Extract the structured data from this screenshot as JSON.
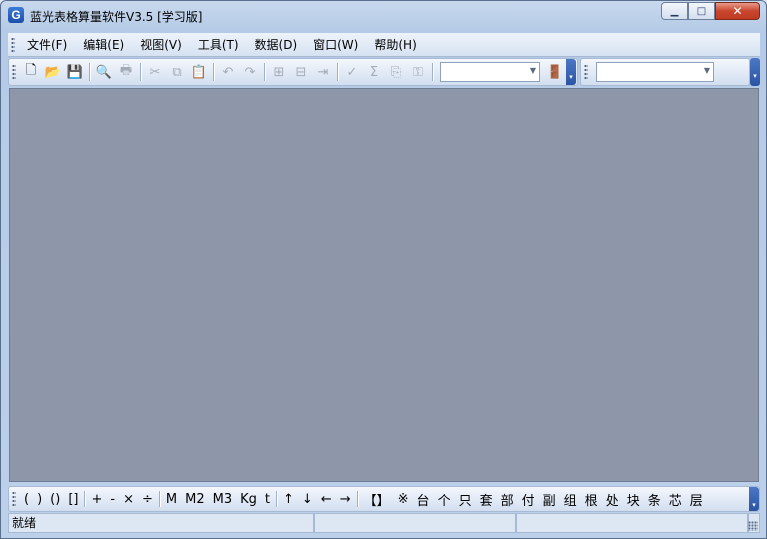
{
  "window": {
    "title": "蓝光表格算量软件V3.5 [学习版]",
    "app_icon_letter": "G",
    "minimize_glyph": "▁",
    "maximize_glyph": "□",
    "close_glyph": "✕"
  },
  "menu": {
    "items": [
      "文件(F)",
      "编辑(E)",
      "视图(V)",
      "工具(T)",
      "数据(D)",
      "窗口(W)",
      "帮助(H)"
    ]
  },
  "toolbar": {
    "buttons": [
      {
        "icon": "new-file-icon",
        "glyph": "🗋",
        "enabled": true
      },
      {
        "icon": "open-folder-icon",
        "glyph": "📂",
        "enabled": true
      },
      {
        "icon": "save-icon",
        "glyph": "💾",
        "enabled": false
      },
      {
        "icon": "print-preview-icon",
        "glyph": "🔍",
        "enabled": false
      },
      {
        "icon": "print-icon",
        "glyph": "🖶",
        "enabled": false
      },
      {
        "icon": "cut-icon",
        "glyph": "✂",
        "enabled": false
      },
      {
        "icon": "copy-icon",
        "glyph": "⧉",
        "enabled": false
      },
      {
        "icon": "paste-icon",
        "glyph": "📋",
        "enabled": false
      },
      {
        "icon": "undo-icon",
        "glyph": "↶",
        "enabled": false
      },
      {
        "icon": "redo-icon",
        "glyph": "↷",
        "enabled": false
      },
      {
        "icon": "insert-row-icon",
        "glyph": "⊞",
        "enabled": false
      },
      {
        "icon": "delete-row-icon",
        "glyph": "⊟",
        "enabled": false
      },
      {
        "icon": "move-row-icon",
        "glyph": "⇥",
        "enabled": false
      },
      {
        "icon": "formula-check-icon",
        "glyph": "✓",
        "enabled": false
      },
      {
        "icon": "sum-icon",
        "glyph": "Σ",
        "enabled": false
      },
      {
        "icon": "export-icon",
        "glyph": "⎘",
        "enabled": false
      },
      {
        "icon": "lock-icon",
        "glyph": "⚿",
        "enabled": false
      },
      {
        "icon": "exit-door-icon",
        "glyph": "🚪",
        "enabled": true
      }
    ],
    "combo1_value": "",
    "combo2_value": "",
    "overflow_glyph": "▾"
  },
  "symbols": {
    "groups": [
      [
        "(",
        ")",
        "()",
        "[]"
      ],
      [
        "+",
        "-",
        "×",
        "÷"
      ],
      [
        "M",
        "M2",
        "M3",
        "Kg",
        "t"
      ],
      [
        "↑",
        "↓",
        "←",
        "→"
      ],
      [
        "【】",
        "※",
        "台",
        "个",
        "只",
        "套",
        "部",
        "付",
        "副",
        "组",
        "根",
        "处",
        "块",
        "条",
        "芯",
        "层"
      ]
    ]
  },
  "status": {
    "ready": "就绪",
    "pane2": "",
    "pane3": "",
    "pane4": ""
  }
}
